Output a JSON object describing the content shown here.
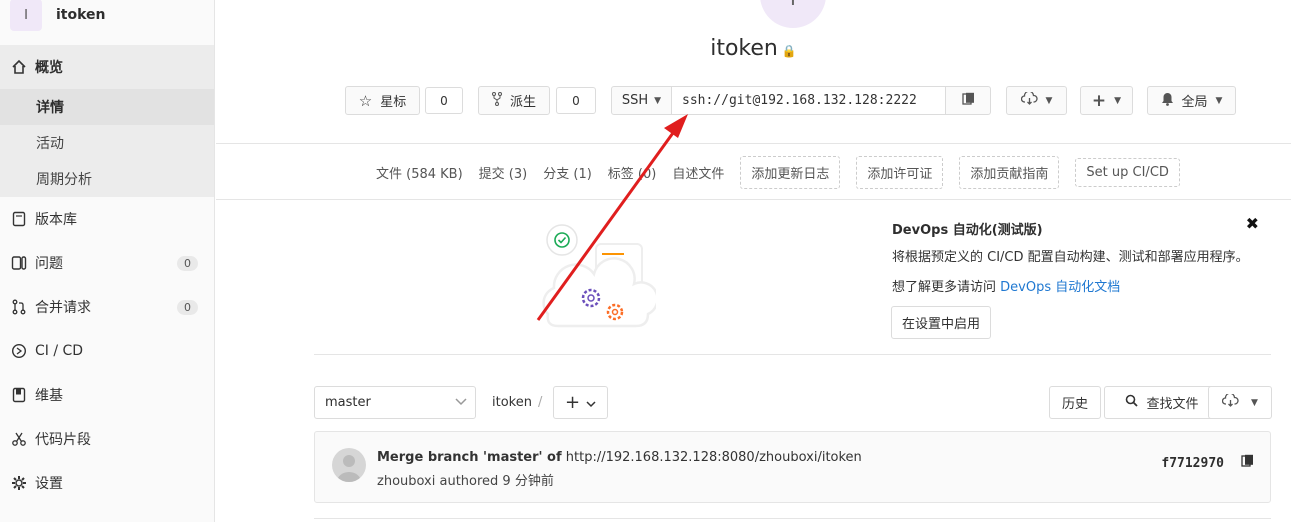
{
  "project": {
    "avatar_letter": "I",
    "name": "itoken"
  },
  "sidebar": {
    "overview": "概览",
    "sub_items": [
      "详情",
      "活动",
      "周期分析"
    ],
    "items": [
      {
        "label": "版本库",
        "icon": "book-icon"
      },
      {
        "label": "问题",
        "icon": "issues-icon",
        "count": "0"
      },
      {
        "label": "合并请求",
        "icon": "merge-request-icon",
        "count": "0"
      },
      {
        "label": "CI / CD",
        "icon": "rocket-icon"
      },
      {
        "label": "维基",
        "icon": "book-open-icon"
      },
      {
        "label": "代码片段",
        "icon": "scissors-icon"
      },
      {
        "label": "设置",
        "icon": "gear-icon"
      }
    ]
  },
  "header": {
    "top_avatar": "I",
    "title": "itoken",
    "star_label": "星标",
    "star_count": "0",
    "fork_label": "派生",
    "fork_count": "0",
    "protocol": "SSH",
    "clone_url": "ssh://git@192.168.132.128:2222",
    "notification": "全局"
  },
  "stats": {
    "files": "文件 (584 KB)",
    "commits": "提交 (3)",
    "branches": "分支 (1)",
    "tags": "标签 (0)",
    "readme": "自述文件",
    "add_changelog": "添加更新日志",
    "add_license": "添加许可证",
    "add_contributing": "添加贡献指南",
    "setup_cicd": "Set up CI/CD"
  },
  "devops": {
    "title": "DevOps 自动化(测试版)",
    "desc": "将根据预定义的 CI/CD 配置自动构建、测试和部署应用程序。",
    "more_prefix": "想了解更多请访问",
    "link": "DevOps 自动化文档",
    "enable": "在设置中启用",
    "close": "✖"
  },
  "tree": {
    "branch": "master",
    "path": "itoken",
    "sep": "/",
    "history": "历史",
    "find_file": "查找文件"
  },
  "commit": {
    "title_bold": "Merge branch 'master' of",
    "title_rest": "http://192.168.132.128:8080/zhouboxi/itoken",
    "meta": "zhouboxi authored 9 分钟前",
    "sha": "f7712970"
  },
  "colors": {
    "link": "#1f78d1",
    "annotation_arrow": "#e01e1e",
    "sidebar_active": "#ececec"
  }
}
